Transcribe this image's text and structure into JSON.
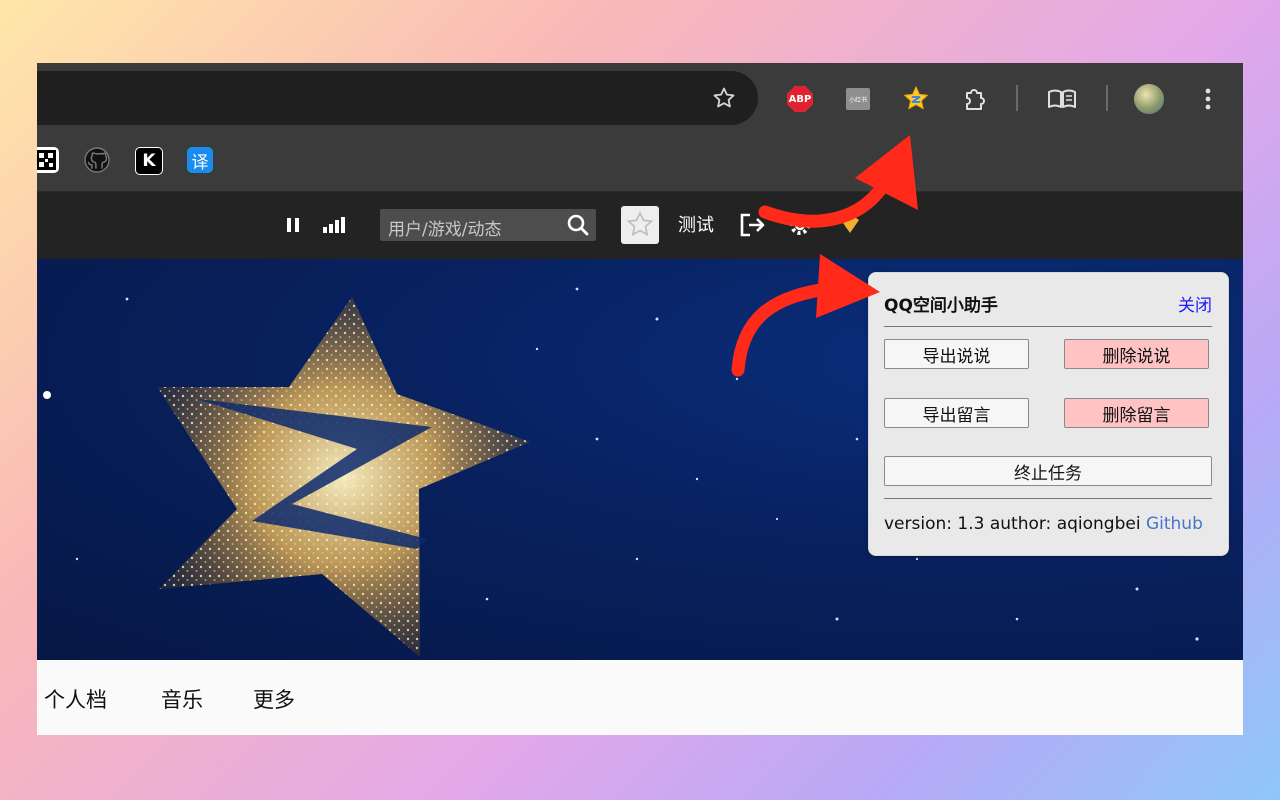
{
  "browser": {
    "extensions": [
      {
        "name": "adblock-plus",
        "label": "ABP"
      },
      {
        "name": "xiaohongshu",
        "label": "小红书"
      },
      {
        "name": "qzone-helper",
        "label": ""
      }
    ]
  },
  "bookmarks": [
    {
      "name": "bookmark-qr",
      "icon": "qr-icon"
    },
    {
      "name": "bookmark-github",
      "icon": "github-icon"
    },
    {
      "name": "bookmark-k",
      "label": "K"
    },
    {
      "name": "bookmark-translate",
      "label": "译"
    }
  ],
  "site": {
    "search_placeholder": "用户/游戏/动态",
    "user_label": "测试"
  },
  "nav": {
    "items": [
      "个人档",
      "音乐",
      "更多"
    ]
  },
  "popup": {
    "title": "QQ空间小助手",
    "close_label": "关闭",
    "export_posts": "导出说说",
    "delete_posts": "删除说说",
    "export_messages": "导出留言",
    "delete_messages": "删除留言",
    "stop_task": "终止任务",
    "footer_text": "version: 1.3 author: aqiongbei",
    "github_link": "Github"
  },
  "colors": {
    "annotation_arrow": "#ff2a1a",
    "danger_button": "#ffc3c3",
    "link": "#1a1aff"
  }
}
